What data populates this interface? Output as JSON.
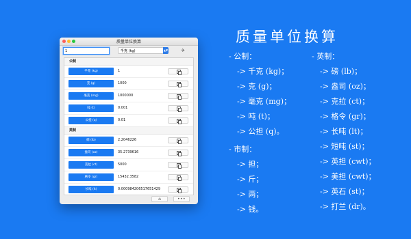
{
  "window": {
    "title": "质量单位换算",
    "input_value": "1",
    "unit_select": "千克 (kg)"
  },
  "sections": [
    {
      "title": "公制",
      "rows": [
        {
          "label": "千克 (kg)",
          "value": "1"
        },
        {
          "label": "克 (g)",
          "value": "1000"
        },
        {
          "label": "毫克 (mg)",
          "value": "1000000"
        },
        {
          "label": "吨 (t)",
          "value": "0.001"
        },
        {
          "label": "公担 (q)",
          "value": "0.01"
        }
      ]
    },
    {
      "title": "英制",
      "rows": [
        {
          "label": "磅 (lb)",
          "value": "2.2046226"
        },
        {
          "label": "盎司 (oz)",
          "value": "35.2739616"
        },
        {
          "label": "克拉 (ct)",
          "value": "5000"
        },
        {
          "label": "格令 (gr)",
          "value": "15432.3582"
        },
        {
          "label": "长吨 (lt)",
          "value": "0.000984206517651429"
        }
      ]
    }
  ],
  "promo": {
    "headline": "质量单位换算",
    "metric_head": "- 公制：",
    "metric_items": [
      "-> 千克 (kg)；",
      "-> 克 (g)；",
      "-> 毫克 (mg)；",
      "-> 吨 (t)；",
      "-> 公担 (q)。"
    ],
    "imperial_head": "- 英制：",
    "imperial_items": [
      "-> 磅 (lb)；",
      "-> 盎司 (oz)；",
      "-> 克拉 (ct)；",
      "-> 格令 (gr)；",
      "-> 长吨 (lt)；",
      "-> 短吨 (st)；",
      "-> 英担 (cwt)；",
      "-> 美担 (cwt)；",
      "-> 英石 (st)；",
      "-> 打兰 (dr)。"
    ],
    "market_head": "- 市制：",
    "market_items": [
      "-> 担；",
      "-> 斤；",
      "-> 两；",
      "-> 钱。"
    ]
  },
  "colors": {
    "background": "#1a7af2",
    "label_button": "#1a7af2"
  }
}
